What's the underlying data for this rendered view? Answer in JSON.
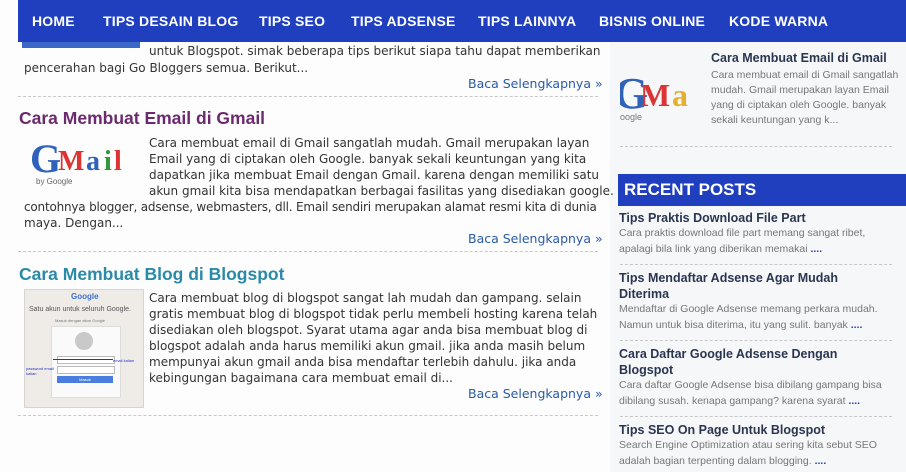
{
  "nav": {
    "items": [
      "HOME",
      "TIPS DESAIN BLOG",
      "TIPS SEO",
      "TIPS ADSENSE",
      "TIPS LAINNYA",
      "BISNIS ONLINE",
      "KODE WARNA"
    ],
    "color": "#1f3fbf"
  },
  "posts": [
    {
      "excerpt_lines": [
        "untuk Blogspot. simak beberapa tips berikut siapa tahu dapat memberikan",
        "pencerahan bagi Go Bloggers semua. Berikut..."
      ],
      "read_more": "Baca Selengkapnya »"
    },
    {
      "title": "Cara Membuat Email di Gmail",
      "title_color": "#6b2a6e",
      "thumbnail_icon": "gmail-logo-icon",
      "excerpt_lines": [
        "Cara membuat email di Gmail sangatlah mudah. Gmail merupakan layan",
        "Email yang di ciptakan oleh Google. banyak sekali keuntungan yang kita",
        "dapatkan jika membuat Email dengan Gmail. karena dengan memiliki satu",
        "akun gmail kita bisa mendapatkan berbagai fasilitas yang disediakan google.",
        "contohnya blogger, adsense, webmasters, dll. Email sendiri merupakan alamat resmi kita di dunia",
        "maya. Dengan..."
      ],
      "read_more": "Baca Selengkapnya »"
    },
    {
      "title": "Cara Membuat Blog di Blogspot",
      "title_color": "#2b8aa8",
      "thumbnail_icon": "google-signup-screenshot",
      "thumbnail_texts": {
        "logo": "Google",
        "heading": "Satu akun untuk seluruh Google.",
        "sub": "Masuk dengan akun Google",
        "email_label": "email kalian",
        "password_label": "password email kalian",
        "button": "Masuk"
      },
      "excerpt_lines": [
        "Cara membuat blog di blogspot sangat lah mudah dan gampang. selain",
        "gratis membuat blog di blogspot  tidak perlu membeli hosting karena telah",
        "disediakan oleh blogspot. Syarat utama agar anda bisa membuat blog di",
        "blogspot adalah anda harus memiliki akun gmail. jika anda masih belum",
        "mempunyai akun gmail anda bisa mendaftar terlebih dahulu. jika anda",
        "kebingungan bagaimana cara membuat email di..."
      ],
      "read_more": "Baca Selengkapnya »"
    }
  ],
  "sidebar": {
    "popular": {
      "title": "Cara Membuat Email di Gmail",
      "excerpt_lines": [
        "Cara membuat email di Gmail sangatlah",
        "mudah. Gmail merupakan layan Email",
        "yang di ciptakan oleh Google. banyak",
        "sekali keuntungan yang k..."
      ]
    },
    "recent_header": "RECENT POSTS",
    "recent_posts": [
      {
        "title_lines": [
          "Tips Praktis Download File Part"
        ],
        "excerpt_lines": [
          "Cara praktis download file part memang sangat ribet,",
          "apalagi bila link yang diberikan memakai"
        ],
        "more": "...."
      },
      {
        "title_lines": [
          "Tips Mendaftar Adsense Agar Mudah",
          "Diterima"
        ],
        "excerpt_lines": [
          "Mendaftar di Google Adsense memang perkara mudah.",
          "Namun untuk bisa diterima, itu yang sulit. banyak"
        ],
        "more": "...."
      },
      {
        "title_lines": [
          "Cara Daftar Google Adsense Dengan",
          "Blogspot"
        ],
        "excerpt_lines": [
          "Cara daftar Google Adsense bisa dibilang gampang bisa",
          "dibilang susah. kenapa gampang? karena syarat"
        ],
        "more": "...."
      },
      {
        "title_lines": [
          "Tips SEO On Page Untuk Blogspot"
        ],
        "excerpt_lines": [
          "Search Engine Optimization atau sering kita sebut SEO",
          "adalah bagian terpenting dalam blogging."
        ],
        "more": "...."
      }
    ]
  }
}
